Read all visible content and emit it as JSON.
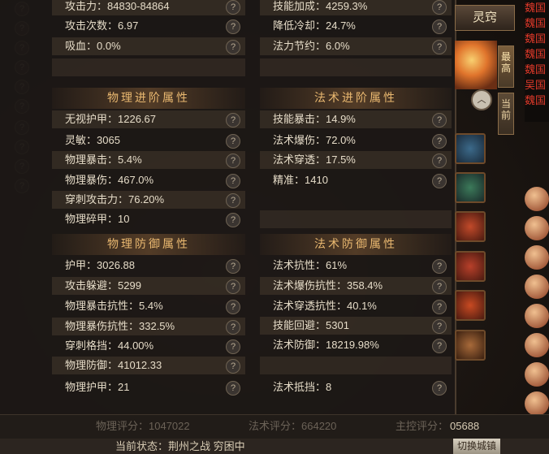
{
  "physical_basic": [
    {
      "label": "攻击力：84830-84864"
    },
    {
      "label": "攻击次数：6.97"
    },
    {
      "label": "吸血：0.0%"
    }
  ],
  "magic_basic": [
    {
      "label": "技能加成：4259.3%"
    },
    {
      "label": "降低冷却：24.7%"
    },
    {
      "label": "法力节约：6.0%"
    }
  ],
  "physical_advanced": {
    "title": "物理进阶属性",
    "rows": [
      {
        "label": "无视护甲：1226.67"
      },
      {
        "label": "灵敏：3065"
      },
      {
        "label": "物理暴击：5.4%"
      },
      {
        "label": "物理暴伤：467.0%"
      },
      {
        "label": "穿刺攻击力：76.20%"
      },
      {
        "label": "物理碎甲：10"
      }
    ]
  },
  "magic_advanced": {
    "title": "法术进阶属性",
    "rows": [
      {
        "label": "技能暴击：14.9%"
      },
      {
        "label": "法术爆伤：72.0%"
      },
      {
        "label": "法术穿透：17.5%"
      },
      {
        "label": "精准：1410"
      }
    ]
  },
  "physical_defense": {
    "title": "物理防御属性",
    "rows": [
      {
        "label": "护甲：3026.88"
      },
      {
        "label": "攻击躲避：5299"
      },
      {
        "label": "物理暴击抗性：5.4%"
      },
      {
        "label": "物理暴伤抗性：332.5%"
      },
      {
        "label": "穿刺格挡：44.00%"
      },
      {
        "label": "物理防御：41012.33"
      },
      {
        "label": "物理护甲：21"
      }
    ]
  },
  "magic_defense": {
    "title": "法术防御属性",
    "rows": [
      {
        "label": "法术抗性：61%"
      },
      {
        "label": "法术爆伤抗性：358.4%"
      },
      {
        "label": "法术穿透抗性：40.1%"
      },
      {
        "label": "技能回避：5301"
      },
      {
        "label": "法术防御：18219.98%"
      },
      {
        "label": "法术抵挡：8"
      }
    ]
  },
  "help_glyph": "?",
  "bottom_bar": {
    "physical_power": "物理评分：1047022",
    "magic_power": "法术评分：664220",
    "main_power_label": "主控评分：",
    "main_power_value": "05688"
  },
  "footer": {
    "current_state": "当前状态：荆州之战 穷困中"
  },
  "right_panel": {
    "lingqiao_label": "灵窍",
    "tab_highest": "最高",
    "tab_current": "当前",
    "switch_city_label": "切换城镇"
  },
  "server_list": [
    "魏国",
    "魏国",
    "魏国",
    "魏国",
    "魏国",
    "吴国",
    "魏国"
  ],
  "colors": {
    "section_title": "#e9b870",
    "server_text": "#e23a2a"
  }
}
